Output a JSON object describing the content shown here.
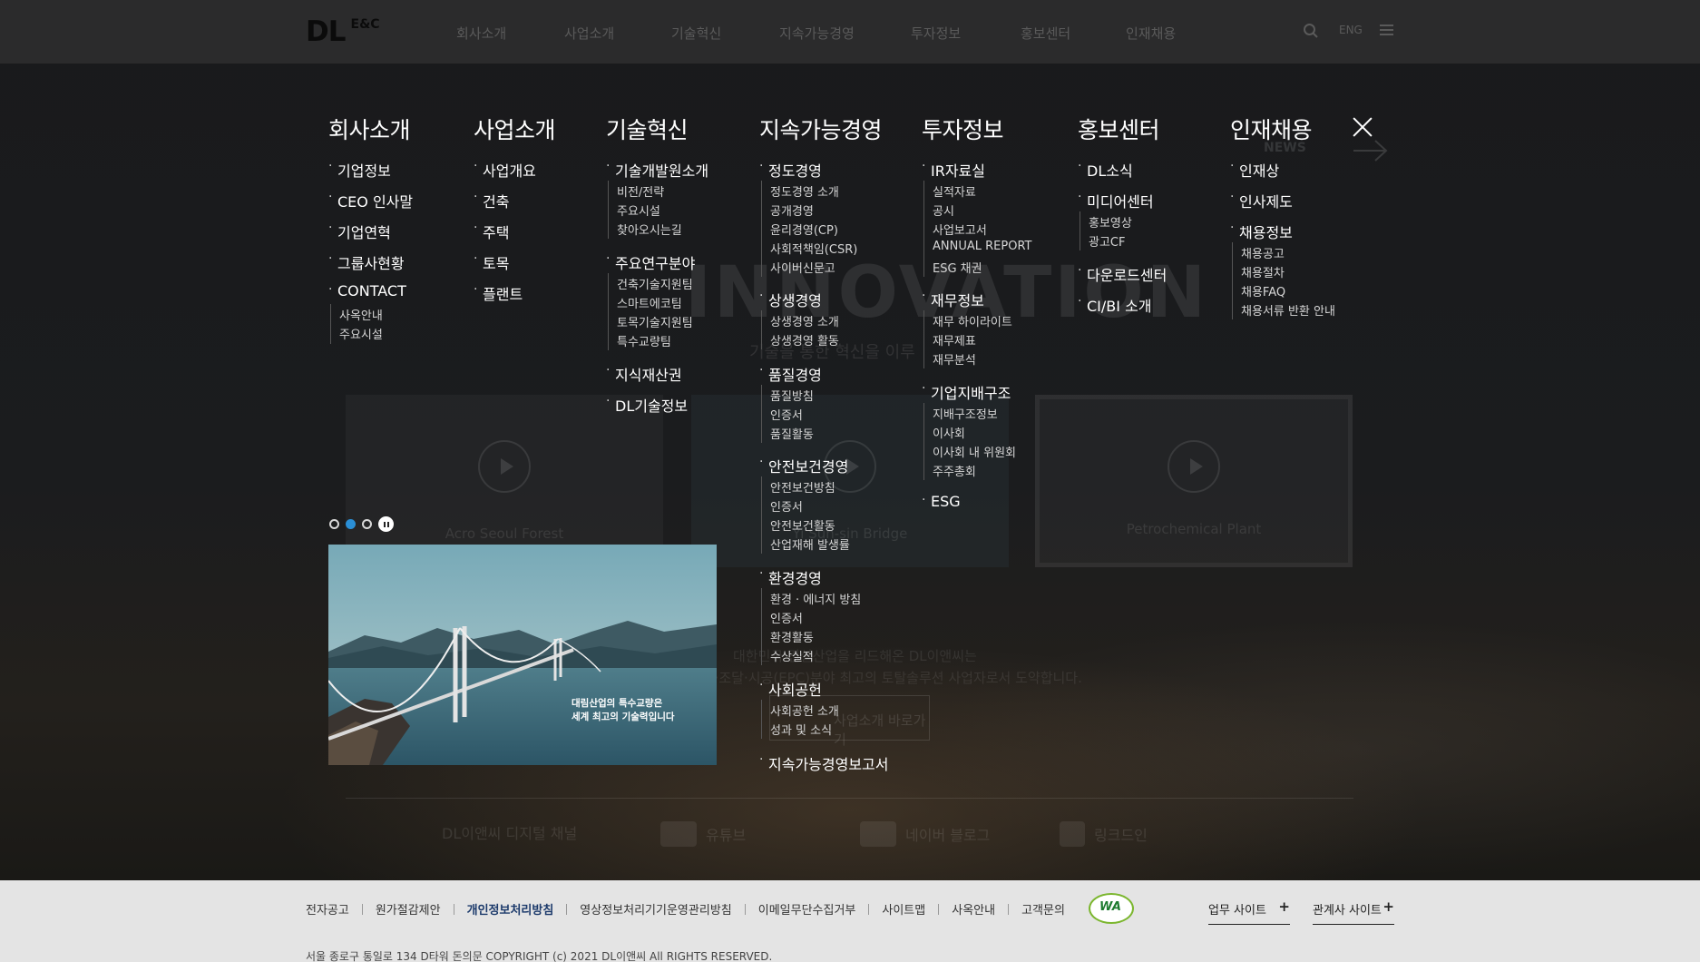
{
  "header": {
    "logo_main": "DL",
    "logo_sub": "E&C",
    "nav": [
      "회사소개",
      "사업소개",
      "기술혁신",
      "지속가능경영",
      "투자정보",
      "홍보센터",
      "인재채용"
    ],
    "lang": "ENG",
    "icons": [
      "search-icon",
      "hamburger-menu-icon"
    ]
  },
  "background": {
    "hero_word": "INNOVATION",
    "hero_sub": "기술을 통한 혁신을 이루",
    "news_label": "NEWS",
    "cards": [
      "Acro Seoul Forest",
      "Yi Sun-sin Bridge",
      "Petrochemical Plant"
    ],
    "text_line1": "대한민국 건설산업을 리드해온 DL이앤씨는",
    "text_line2": "설계·조달·시공(EPC)분야 최고의 토탈솔루션 사업자로서 도약합니다.",
    "button_label": "사업소개 바로가기",
    "social": [
      "DL이앤씨 디지털 채널",
      "유튜브",
      "네이버 블로그",
      "링크드인"
    ]
  },
  "mega_menu": {
    "company": {
      "title": "회사소개",
      "items": [
        "기업정보",
        "CEO 인사말",
        "기업연혁",
        "그룹사현황",
        "CONTACT"
      ],
      "contact_sub": [
        "사옥안내",
        "주요시설"
      ]
    },
    "business": {
      "title": "사업소개",
      "items": [
        "사업개요",
        "건축",
        "주택",
        "토목",
        "플랜트"
      ]
    },
    "tech": {
      "title": "기술혁신",
      "groups": [
        {
          "label": "기술개발원소개",
          "subs": [
            "비전/전략",
            "주요시설",
            "찾아오시는길"
          ]
        },
        {
          "label": "주요연구분야",
          "subs": [
            "건축기술지원팀",
            "스마트에코팀",
            "토목기술지원팀",
            "특수교량팀"
          ]
        },
        {
          "label": "지식재산권",
          "subs": []
        },
        {
          "label": "DL기술정보",
          "subs": []
        }
      ]
    },
    "sustain": {
      "title": "지속가능경영",
      "groups": [
        {
          "label": "정도경영",
          "subs": [
            "정도경영 소개",
            "공개경영",
            "윤리경영(CP)",
            "사회적책임(CSR)",
            "사이버신문고"
          ]
        },
        {
          "label": "상생경영",
          "subs": [
            "상생경영 소개",
            "상생경영 활동"
          ]
        },
        {
          "label": "품질경영",
          "subs": [
            "품질방침",
            "인증서",
            "품질활동"
          ]
        },
        {
          "label": "안전보건경영",
          "subs": [
            "안전보건방침",
            "인증서",
            "안전보건활동",
            "산업재해 발생률"
          ]
        },
        {
          "label": "환경경영",
          "subs": [
            "환경 · 에너지 방침",
            "인증서",
            "환경활동",
            "수상실적"
          ]
        },
        {
          "label": "사회공헌",
          "subs": [
            "사회공헌 소개",
            "성과 및 소식"
          ]
        },
        {
          "label": "지속가능경영보고서",
          "subs": []
        }
      ]
    },
    "ir": {
      "title": "투자정보",
      "groups": [
        {
          "label": "IR자료실",
          "subs": [
            "실적자료",
            "공시",
            "사업보고서",
            "ANNUAL REPORT",
            "ESG 채권"
          ]
        },
        {
          "label": "재무정보",
          "subs": [
            "재무 하이라이트",
            "재무제표",
            "재무분석"
          ]
        },
        {
          "label": "기업지배구조",
          "subs": [
            "지배구조정보",
            "이사회",
            "이사회 내 위원회",
            "주주총회"
          ]
        },
        {
          "label": "ESG",
          "subs": []
        }
      ]
    },
    "pr": {
      "title": "홍보센터",
      "groups": [
        {
          "label": "DL소식",
          "subs": []
        },
        {
          "label": "미디어센터",
          "subs": [
            "홍보영상",
            "광고CF"
          ]
        },
        {
          "label": "다운로드센터",
          "subs": []
        },
        {
          "label": "CI/BI 소개",
          "subs": []
        }
      ]
    },
    "recruit": {
      "title": "인재채용",
      "groups": [
        {
          "label": "인재상",
          "subs": []
        },
        {
          "label": "인사제도",
          "subs": []
        },
        {
          "label": "채용정보",
          "subs": [
            "채용공고",
            "채용절차",
            "채용FAQ",
            "채용서류 반환 안내"
          ]
        }
      ]
    },
    "promo_text": [
      "대림산업의 특수교량은",
      "세계 최고의 기술력입니다"
    ],
    "slider_dots": 3,
    "slider_active": 2
  },
  "footer": {
    "links": [
      "전자공고",
      "원가절감제안",
      "개인정보처리방침",
      "영상정보처리기기운영관리방침",
      "이메일무단수집거부",
      "사이트맵",
      "사옥안내",
      "고객문의"
    ],
    "highlight_link": "개인정보처리방침",
    "wa_mark": "WA",
    "select_business": "업무 사이트",
    "select_affiliate": "관계사 사이트",
    "copyright": "서울 종로구 통일로 134 D타워 돈의문 COPYRIGHT (c) 2021 DL이앤씨 All RIGHTS RESERVED."
  },
  "colors": {
    "header_bg": "#2b2b2c",
    "footer_bg": "#e4e4e4",
    "accent_dot": "#2a8fd6",
    "highlight_link": "#1c3a6b"
  }
}
